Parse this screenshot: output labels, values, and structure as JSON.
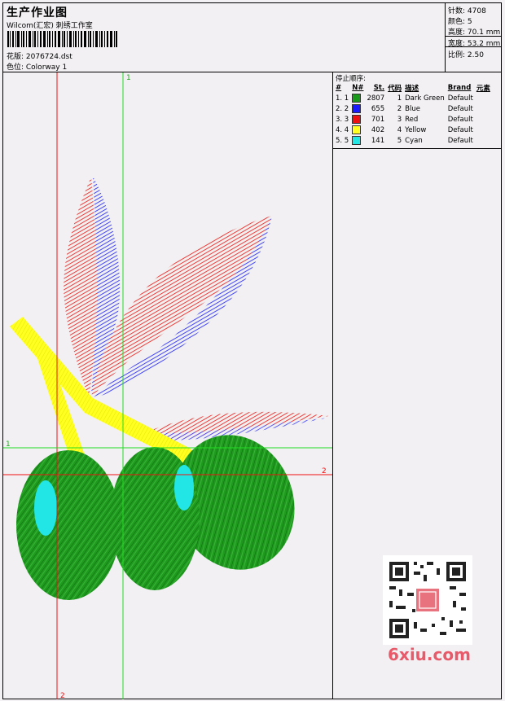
{
  "header": {
    "title": "生产作业图",
    "company": "Wilcom(汇宏) 刺绣工作室",
    "design_label": "花版: 2076724.dst",
    "colorway_label": "色位: Colorway 1"
  },
  "stats": {
    "stitches": "针数: 4708",
    "colors": "颜色: 5",
    "height": "高度: 70.1 mm",
    "width": "宽度: 53.2 mm",
    "scale": "比例: 2.50"
  },
  "legend": {
    "caption": "停止顺序:",
    "headers": [
      "#",
      "N#",
      "St.",
      "代码",
      "描述",
      "Brand",
      "元素"
    ],
    "rows": [
      {
        "idx": "1. 1",
        "stitches": "2807",
        "code": "1",
        "desc": "Dark Green",
        "brand": "Default",
        "color": "#1a9a1a"
      },
      {
        "idx": "2. 2",
        "stitches": "655",
        "code": "2",
        "desc": "Blue",
        "brand": "Default",
        "color": "#1a1aff"
      },
      {
        "idx": "3. 3",
        "stitches": "701",
        "code": "3",
        "desc": "Red",
        "brand": "Default",
        "color": "#ee1111"
      },
      {
        "idx": "4. 4",
        "stitches": "402",
        "code": "4",
        "desc": "Yellow",
        "brand": "Default",
        "color": "#ffff22"
      },
      {
        "idx": "5. 5",
        "stitches": "141",
        "code": "5",
        "desc": "Cyan",
        "brand": "Default",
        "color": "#22e6e6"
      }
    ]
  },
  "guides": {
    "vertical_1": "1",
    "horizontal_1": "1",
    "horizontal_2": "2",
    "vertical_2": "2"
  },
  "watermark": "6xiu.com"
}
